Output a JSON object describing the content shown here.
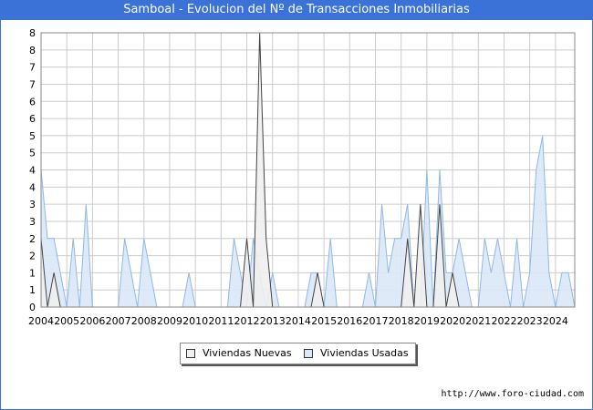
{
  "title": "Samboal - Evolucion del Nº de Transacciones Inmobiliarias",
  "footer_url": "http://www.foro-ciudad.com",
  "colors": {
    "title_bg": "#3a72d8",
    "nuevas_fill": "#f0f0f0",
    "nuevas_line": "#444444",
    "usadas_fill": "#dbe8f8",
    "usadas_line": "#8fb8e6",
    "grid": "#cccccc"
  },
  "chart_data": {
    "type": "area",
    "title": "Samboal - Evolucion del Nº de Transacciones Inmobiliarias",
    "xlabel": "",
    "ylabel": "",
    "ylim": [
      0,
      8
    ],
    "yticks": [
      0,
      1,
      2,
      3,
      4,
      5,
      6,
      7,
      8
    ],
    "ytick_labels": [
      "0",
      "1",
      "1",
      "2",
      "2",
      "3",
      "3",
      "4",
      "4",
      "5",
      "5",
      "6",
      "6",
      "7",
      "7",
      "8",
      "8"
    ],
    "xlim": [
      2004,
      2024.75
    ],
    "year_labels": [
      "2004",
      "2005",
      "2006",
      "2007",
      "2008",
      "2009",
      "2010",
      "2011",
      "2012",
      "2013",
      "2014",
      "2015",
      "2016",
      "2017",
      "2018",
      "2019",
      "2020",
      "2021",
      "2022",
      "2023",
      "2024"
    ],
    "grid": true,
    "legend_position": "bottom-center",
    "series": [
      {
        "name": "Viviendas Nuevas",
        "x": [
          2004.0,
          2004.25,
          2004.5,
          2004.75,
          2005.0,
          2011.75,
          2012.0,
          2012.25,
          2012.5,
          2012.75,
          2013.0,
          2014.5,
          2014.75,
          2015.0,
          2017.75,
          2018.0,
          2018.25,
          2018.5,
          2018.75,
          2019.0,
          2019.25,
          2019.5,
          2019.75,
          2020.0,
          2020.25,
          2020.5
        ],
        "values": [
          2,
          0,
          1,
          0,
          0,
          0,
          2,
          0,
          8,
          2,
          0,
          0,
          1,
          0,
          0,
          0,
          2,
          0,
          3,
          0,
          0,
          3,
          0,
          1,
          0,
          0
        ]
      },
      {
        "name": "Viviendas Usadas",
        "x": [
          2004.0,
          2004.25,
          2004.5,
          2004.75,
          2005.0,
          2005.25,
          2005.5,
          2005.75,
          2006.0,
          2006.25,
          2007.0,
          2007.25,
          2007.5,
          2007.75,
          2008.0,
          2008.25,
          2008.5,
          2008.75,
          2009.5,
          2009.75,
          2010.0,
          2011.0,
          2011.25,
          2011.5,
          2011.75,
          2012.0,
          2012.25,
          2012.5,
          2012.75,
          2013.0,
          2013.25,
          2013.5,
          2014.25,
          2014.5,
          2014.75,
          2015.0,
          2015.25,
          2015.5,
          2016.25,
          2016.5,
          2016.75,
          2017.0,
          2017.25,
          2017.5,
          2017.75,
          2018.0,
          2018.25,
          2018.5,
          2018.75,
          2019.0,
          2019.25,
          2019.5,
          2019.75,
          2020.0,
          2020.25,
          2020.5,
          2020.75,
          2021.0,
          2021.25,
          2021.5,
          2021.75,
          2022.0,
          2022.25,
          2022.5,
          2022.75,
          2023.0,
          2023.25,
          2023.5,
          2023.75,
          2024.0,
          2024.25,
          2024.5,
          2024.75
        ],
        "values": [
          4,
          2,
          2,
          1,
          0,
          2,
          0,
          3,
          0,
          0,
          0,
          2,
          1,
          0,
          2,
          1,
          0,
          0,
          0,
          1,
          0,
          0,
          0,
          2,
          1,
          0,
          2,
          1,
          0,
          1,
          0,
          0,
          0,
          1,
          1,
          0,
          2,
          0,
          0,
          0,
          1,
          0,
          3,
          1,
          2,
          2,
          3,
          0,
          0,
          4,
          0,
          4,
          1,
          1,
          2,
          1,
          0,
          0,
          2,
          1,
          2,
          1,
          0,
          2,
          0,
          1,
          4,
          5,
          1,
          0,
          1,
          1,
          0
        ]
      }
    ]
  },
  "legend": [
    {
      "label": "Viviendas Nuevas"
    },
    {
      "label": "Viviendas Usadas"
    }
  ]
}
